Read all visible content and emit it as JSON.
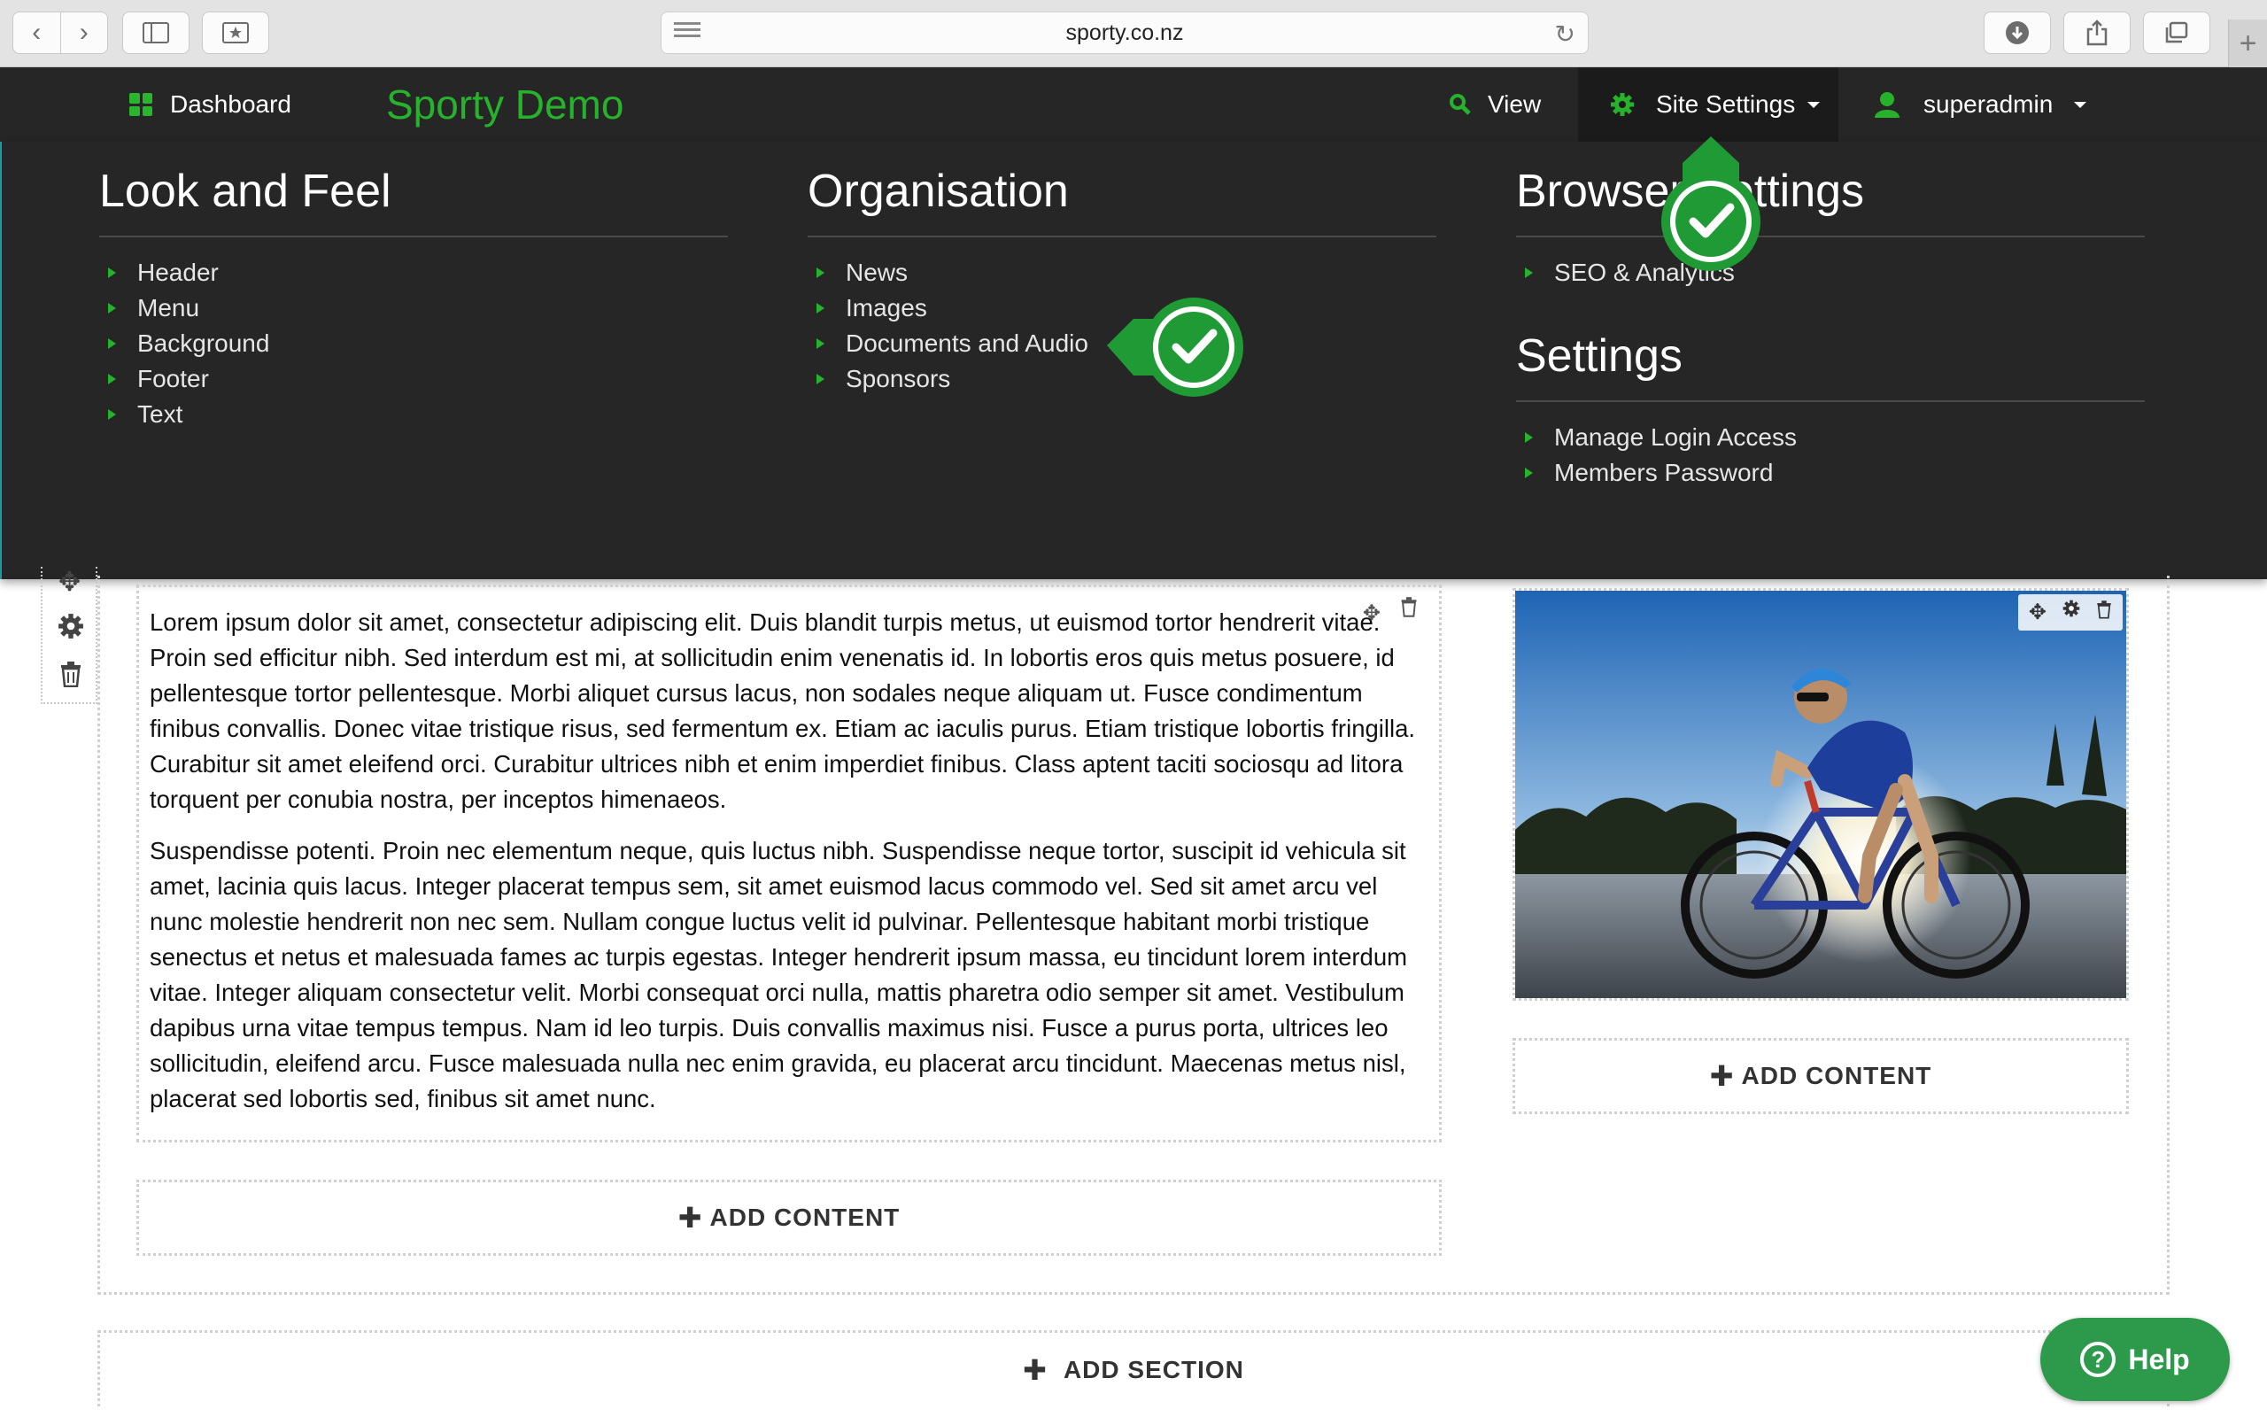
{
  "browser": {
    "url": "sporty.co.nz",
    "back_glyph": "‹",
    "forward_glyph": "›",
    "new_tab_glyph": "+",
    "reload_glyph": "↻"
  },
  "appbar": {
    "dashboard_label": "Dashboard",
    "brand": "Sporty Demo",
    "view_label": "View",
    "site_settings_label": "Site Settings",
    "user_label": "superadmin"
  },
  "menu": {
    "look_and_feel": {
      "title": "Look and Feel",
      "items": [
        "Header",
        "Menu",
        "Background",
        "Footer",
        "Text"
      ]
    },
    "organisation": {
      "title": "Organisation",
      "items": [
        "News",
        "Images",
        "Documents and Audio",
        "Sponsors"
      ]
    },
    "browser_settings": {
      "title": "Browser Settings",
      "items": [
        "SEO & Analytics"
      ]
    },
    "settings": {
      "title": "Settings",
      "items": [
        "Manage Login Access",
        "Members Password"
      ]
    }
  },
  "content": {
    "paragraph_1": "Lorem ipsum dolor sit amet, consectetur adipiscing elit. Duis blandit turpis metus, ut euismod tortor hendrerit vitae. Proin sed efficitur nibh. Sed interdum est mi, at sollicitudin enim venenatis id. In lobortis eros quis metus posuere, id pellentesque tortor pellentesque. Morbi aliquet cursus lacus, non sodales neque aliquam ut. Fusce condimentum finibus convallis. Donec vitae tristique risus, sed fermentum ex. Etiam ac iaculis purus. Etiam tristique lobortis fringilla. Curabitur sit amet eleifend orci. Curabitur ultrices nibh et enim imperdiet finibus. Class aptent taciti sociosqu ad litora torquent per conubia nostra, per inceptos himenaeos.",
    "paragraph_2": "Suspendisse potenti. Proin nec elementum neque, quis luctus nibh. Suspendisse neque tortor, suscipit id vehicula sit amet, lacinia quis lacus. Integer placerat tempus sem, sit amet euismod lacus commodo vel. Sed sit amet arcu vel nunc molestie hendrerit non nec sem. Nullam congue luctus velit id pulvinar. Pellentesque habitant morbi tristique senectus et netus et malesuada fames ac turpis egestas. Integer hendrerit ipsum massa, eu tincidunt lorem interdum vitae. Integer aliquam consectetur velit. Morbi consequat orci nulla, mattis pharetra odio semper sit amet. Vestibulum dapibus urna vitae tempus tempus. Nam id leo turpis. Duis convallis maximus nisi. Fusce a purus porta, ultrices leo sollicitudin, eleifend arcu. Fusce malesuada nulla nec enim gravida, eu placerat arcu tincidunt. Maecenas metus nisl, placerat sed lobortis sed, finibus sit amet nunc.",
    "add_content_label": "ADD CONTENT",
    "add_section_label": "ADD SECTION",
    "plus_glyph": "✚"
  },
  "help": {
    "label": "Help",
    "glyph": "?"
  },
  "colors": {
    "accent_green": "#27b22b",
    "dark_bar": "#262626",
    "help_green": "#2d9a4b"
  }
}
